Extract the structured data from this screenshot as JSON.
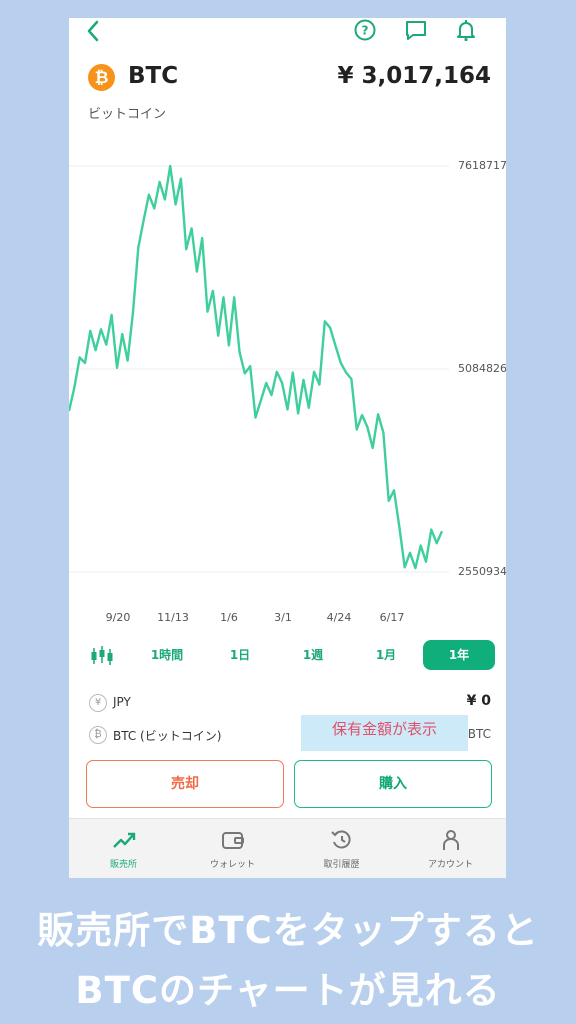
{
  "header": {
    "symbol": "BTC",
    "coin_glyph": "₿",
    "price": "¥ 3,017,164",
    "name_jp": "ビットコイン",
    "icons": [
      "back-icon",
      "help-icon",
      "chat-icon",
      "bell-icon"
    ]
  },
  "chart_data": {
    "type": "line",
    "y_ticks": [
      "7618717",
      "5084826",
      "2550934"
    ],
    "y_tick_values": [
      7618717,
      5084826,
      2550934
    ],
    "ylim": [
      2550934,
      7618717
    ],
    "x_ticks": [
      "9/20",
      "11/13",
      "1/6",
      "3/1",
      "4/24",
      "6/17"
    ],
    "series": [
      {
        "values": [
          4560000,
          4850000,
          5230000,
          5160000,
          5560000,
          5320000,
          5580000,
          5390000,
          5760000,
          5100000,
          5520000,
          5190000,
          5780000,
          6600000,
          6940000,
          7260000,
          7090000,
          7420000,
          7200000,
          7620000,
          7140000,
          7460000,
          6580000,
          6840000,
          6300000,
          6720000,
          5800000,
          6060000,
          5500000,
          5980000,
          5380000,
          5980000,
          5300000,
          5030000,
          5120000,
          4480000,
          4690000,
          4910000,
          4760000,
          5050000,
          4910000,
          4580000,
          5040000,
          4530000,
          4950000,
          4600000,
          5050000,
          4890000,
          5680000,
          5600000,
          5380000,
          5160000,
          5040000,
          4960000,
          4330000,
          4510000,
          4360000,
          4100000,
          4520000,
          4290000,
          3440000,
          3570000,
          3110000,
          2610000,
          2790000,
          2600000,
          2880000,
          2680000,
          3080000,
          2910000,
          3060000
        ]
      }
    ],
    "colors": {
      "line": "#3ecf9b",
      "grid": "#eeeeee"
    }
  },
  "ranges": {
    "candle_icon": "candlestick-icon",
    "items": [
      "1時間",
      "1日",
      "1週",
      "1月",
      "1年"
    ],
    "active": "1年"
  },
  "balances": {
    "jpy": {
      "icon": "¥",
      "label": "JPY",
      "value": "¥ 0"
    },
    "btc": {
      "icon": "₿",
      "label": "BTC (ビットコイン)",
      "value": "BTC"
    }
  },
  "annotation": "保有金額が表示",
  "actions": {
    "sell": "売却",
    "buy": "購入"
  },
  "tabs": [
    {
      "label": "販売所",
      "icon": "trend-icon",
      "active": true
    },
    {
      "label": "ウォレット",
      "icon": "wallet-icon",
      "active": false
    },
    {
      "label": "取引履歴",
      "icon": "history-icon",
      "active": false
    },
    {
      "label": "アカウント",
      "icon": "person-icon",
      "active": false
    }
  ],
  "caption": {
    "line1": "販売所でBTCをタップすると",
    "line2": "BTCのチャートが見れる"
  },
  "colors": {
    "accent": "#0fae7a",
    "sell": "#f06a45",
    "background": "#b9cfee",
    "btc": "#f7931a"
  }
}
